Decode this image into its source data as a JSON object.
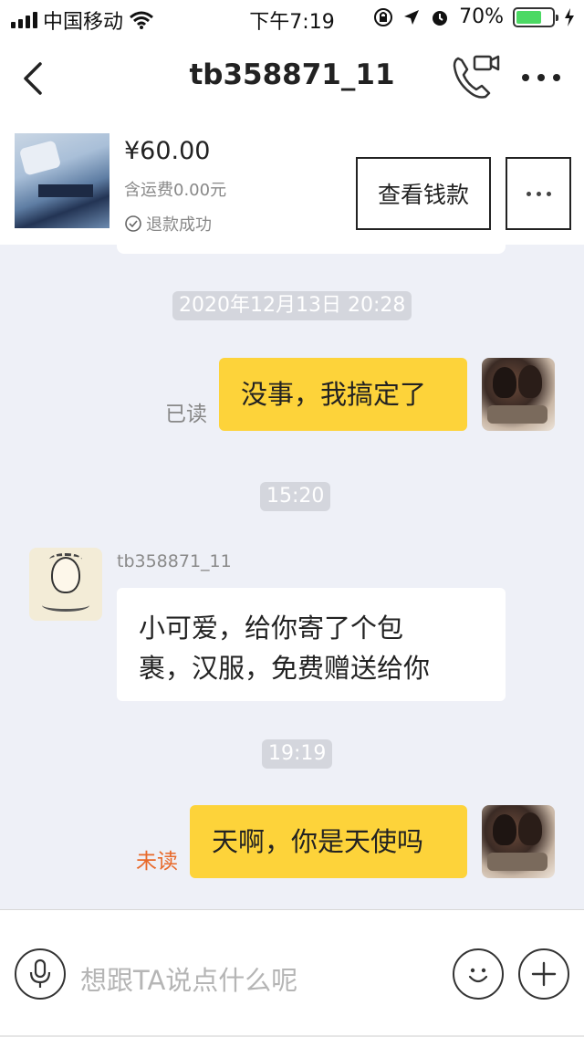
{
  "status_bar": {
    "carrier": "中国移动",
    "time": "下午7:19",
    "battery": "70%",
    "battery_level": 0.7,
    "icons": [
      "signal-icon",
      "wifi-icon",
      "lock-rotation-icon",
      "location-icon",
      "alarm-icon",
      "battery-icon",
      "charging-icon"
    ]
  },
  "nav": {
    "title": "tb358871_11",
    "icons": [
      "back-icon",
      "video-call-icon",
      "more-icon"
    ]
  },
  "product": {
    "price": "¥60.00",
    "shipping": "含运费0.00元",
    "status": "退款成功",
    "view_button": "查看钱款",
    "more_button_icon": "more-icon"
  },
  "messages": {
    "time1": "2020年12月13日 20:28",
    "msg1": {
      "text": "没事，我搞定了",
      "status": "已读"
    },
    "time2": "15:20",
    "msg2": {
      "sender": "tb358871_11",
      "text_line1": "小可爱，给你寄了个包",
      "text_line2": "裹，汉服，免费赠送给你"
    },
    "time3": "19:19",
    "msg3": {
      "text": "天啊，你是天使吗",
      "status": "未读"
    }
  },
  "input": {
    "placeholder": "想跟TA说点什么呢",
    "icons": [
      "microphone-icon",
      "emoji-icon",
      "plus-icon"
    ]
  },
  "colors": {
    "my_bubble": "#fdd33a",
    "unread": "#e8692a",
    "read": "#888888",
    "background": "#eef0f7"
  }
}
